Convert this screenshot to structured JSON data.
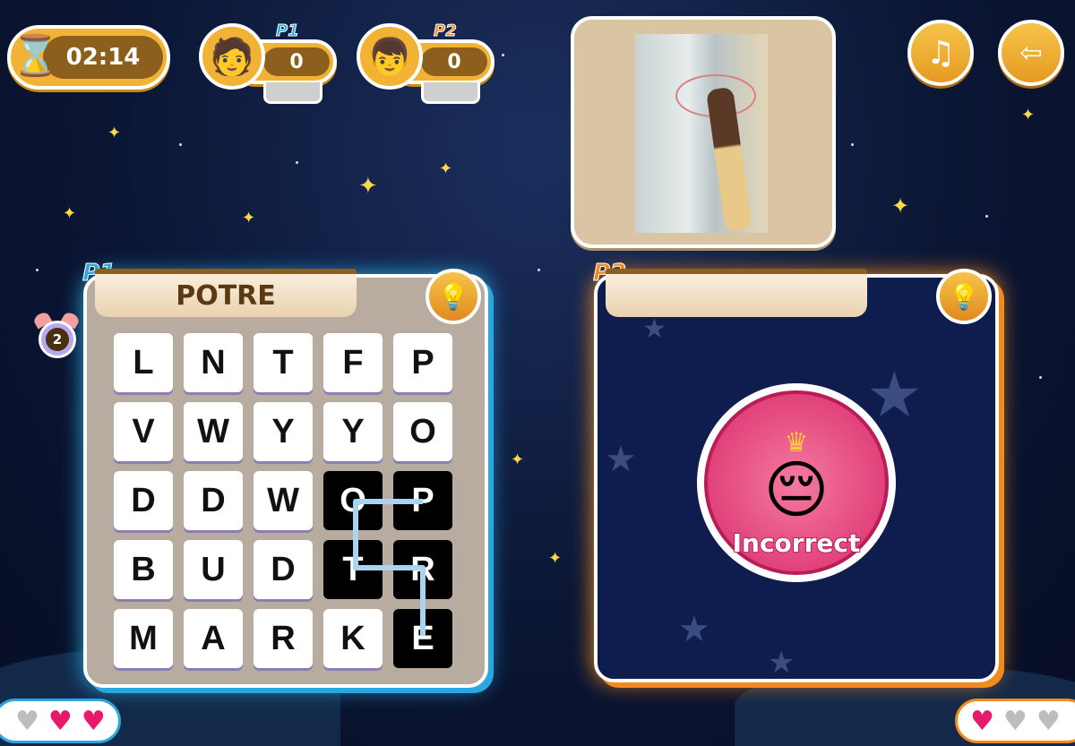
{
  "timer": {
    "value": "02:14",
    "icon": "hourglass-icon"
  },
  "players": [
    {
      "tag": "P1",
      "score": "0",
      "color": "#2aa7e0"
    },
    {
      "tag": "P2",
      "score": "0",
      "color": "#f28a1c"
    }
  ],
  "buttons": {
    "music_icon": "music-note-icon",
    "exit_icon": "exit-door-icon"
  },
  "p1_board": {
    "tag": "P1",
    "word": "POTRE",
    "alarm_count": "2",
    "grid": [
      [
        "L",
        "N",
        "T",
        "F",
        "P"
      ],
      [
        "V",
        "W",
        "Y",
        "Y",
        "O"
      ],
      [
        "D",
        "D",
        "W",
        "O",
        "P"
      ],
      [
        "B",
        "U",
        "D",
        "T",
        "R"
      ],
      [
        "M",
        "A",
        "R",
        "K",
        "E"
      ]
    ],
    "selected": [
      [
        2,
        4
      ],
      [
        2,
        3
      ],
      [
        3,
        3
      ],
      [
        3,
        4
      ],
      [
        4,
        4
      ]
    ]
  },
  "p2_board": {
    "tag": "P2",
    "word": "",
    "result": "Incorrect"
  },
  "lives": {
    "p1": [
      false,
      true,
      true
    ],
    "p2": [
      true,
      false,
      false
    ]
  },
  "colors": {
    "heart_full": "#e8196b",
    "heart_empty": "#bdbdbd",
    "p1_border": "#2aa7e0",
    "p2_border": "#f28a1c"
  }
}
